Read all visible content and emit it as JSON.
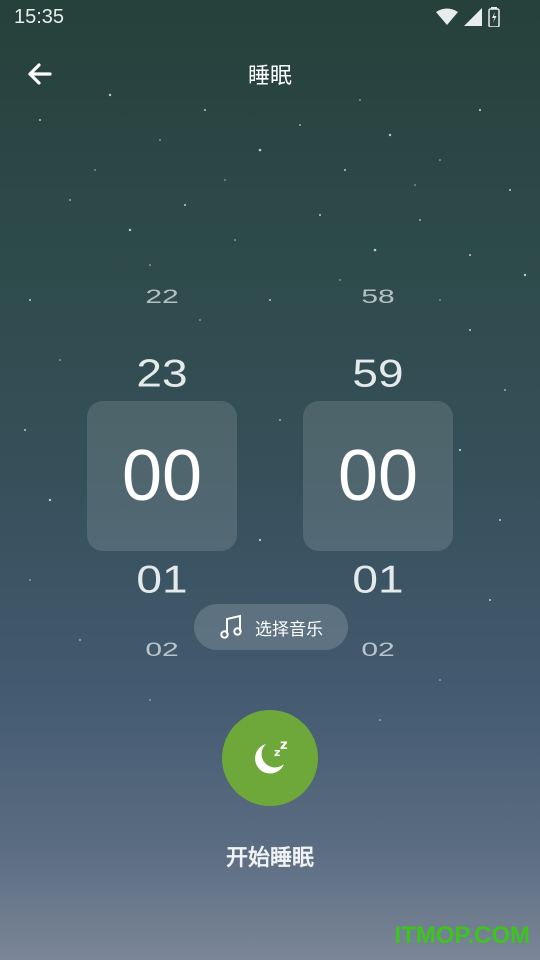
{
  "status_bar": {
    "time": "15:35"
  },
  "header": {
    "title": "睡眠"
  },
  "picker": {
    "hours": {
      "far_above": "22",
      "above": "23",
      "selected": "00",
      "below": "01",
      "far_below": "02"
    },
    "minutes": {
      "far_above": "58",
      "above": "59",
      "selected": "00",
      "below": "01",
      "far_below": "02"
    }
  },
  "music": {
    "label": "选择音乐",
    "icon": "music-note-icon"
  },
  "sleep": {
    "label": "开始睡眠",
    "icon": "moon-zzz-icon",
    "color": "#6ea83a"
  },
  "watermark": "ITMOP.COM"
}
